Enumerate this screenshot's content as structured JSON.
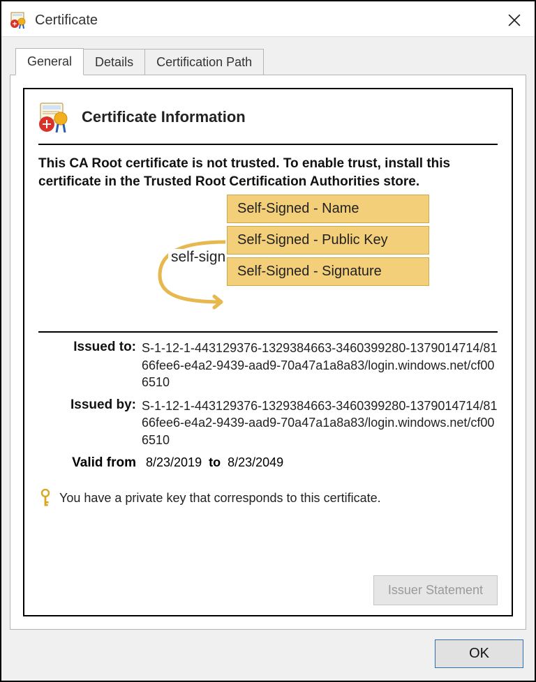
{
  "window": {
    "title": "Certificate"
  },
  "tabs": {
    "general": "General",
    "details": "Details",
    "certpath": "Certification Path"
  },
  "panel": {
    "heading": "Certificate Information",
    "trust_message": "This CA Root certificate is not trusted. To enable trust, install this certificate in the Trusted Root Certification Authorities store.",
    "overlay": {
      "self_sign_label": "self-sign",
      "box_name": "Self-Signed - Name",
      "box_publickey": "Self-Signed - Public Key",
      "box_signature": "Self-Signed - Signature"
    },
    "issued_to": {
      "label": "Issued to:",
      "value": "S-1-12-1-443129376-1329384663-3460399280-1379014714/8166fee6-e4a2-9439-aad9-70a47a1a8a83/login.windows.net/cf006510"
    },
    "issued_by": {
      "label": "Issued by:",
      "value": "S-1-12-1-443129376-1329384663-3460399280-1379014714/8166fee6-e4a2-9439-aad9-70a47a1a8a83/login.windows.net/cf006510"
    },
    "valid": {
      "label": "Valid from",
      "from": "8/23/2019",
      "to_label": "to",
      "to": "8/23/2049"
    },
    "private_key_note": "You have a private key that corresponds to this certificate.",
    "issuer_statement_button": "Issuer Statement"
  },
  "buttons": {
    "ok": "OK"
  }
}
